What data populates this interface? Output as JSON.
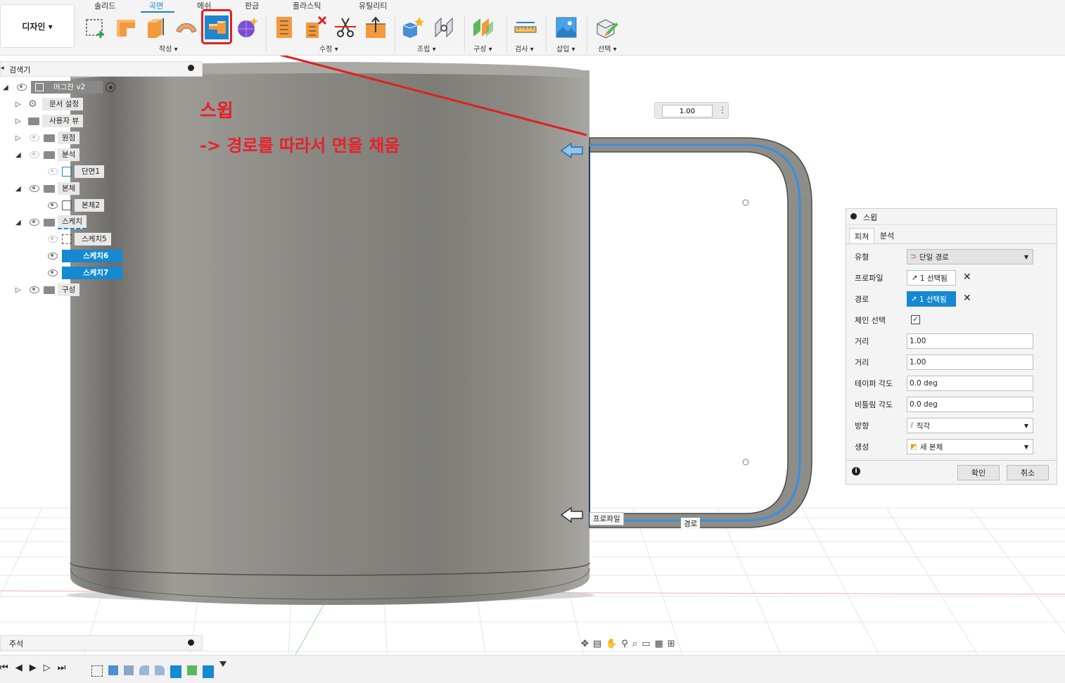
{
  "workspace": {
    "label": "디자인 ▾"
  },
  "tabs": [
    {
      "label": "솔리드",
      "active": false
    },
    {
      "label": "곡면",
      "active": true
    },
    {
      "label": "메쉬",
      "active": false
    },
    {
      "label": "판금",
      "active": false
    },
    {
      "label": "플라스틱",
      "active": false
    },
    {
      "label": "유틸리티",
      "active": false
    }
  ],
  "groups": {
    "create": "작성 ▾",
    "modify": "수정 ▾",
    "assemble": "조립 ▾",
    "construct": "구성 ▾",
    "inspect": "검사 ▾",
    "insert": "삽입 ▾",
    "select": "선택 ▾"
  },
  "annotation": {
    "title": "스윕",
    "description": "-> 경로를 따라서 면을 채움",
    "color": "#e8202a"
  },
  "browser": {
    "title": "검색기",
    "root": "머그잔 v2",
    "nodes": [
      {
        "label": "문서 설정"
      },
      {
        "label": "사용자 뷰"
      },
      {
        "label": "원점"
      },
      {
        "label": "분석"
      },
      {
        "label": "단면1"
      },
      {
        "label": "본체"
      },
      {
        "label": "본체2"
      },
      {
        "label": "스케치"
      },
      {
        "label": "스케치5"
      },
      {
        "label": "스케치6",
        "selected": true
      },
      {
        "label": "스케치7",
        "selected": true
      },
      {
        "label": "구성"
      }
    ]
  },
  "viewport": {
    "distance_input": "1.00",
    "profile_label": "프로파일",
    "path_label": "경로"
  },
  "dialog": {
    "title": "스윕",
    "tabs": [
      "피쳐",
      "분석"
    ],
    "rows": {
      "type_label": "유형",
      "type_value": "단일 경로",
      "profile_label": "프로파일",
      "profile_value": "1 선택됨",
      "path_label": "경로",
      "path_value": "1 선택됨",
      "chain_label": "체인 선택",
      "distance1_label": "거리",
      "distance1_value": "1.00",
      "distance2_label": "거리",
      "distance2_value": "1.00",
      "taper_label": "테이퍼 각도",
      "taper_value": "0.0 deg",
      "twist_label": "비틀림 각도",
      "twist_value": "0.0 deg",
      "orientation_label": "방향",
      "orientation_value": "직각",
      "operation_label": "생성",
      "operation_value": "새 본체"
    },
    "ok": "확인",
    "cancel": "취소"
  },
  "comments": {
    "title": "주석"
  },
  "colors": {
    "accent": "#1a7fd6",
    "selection": "#1589d1",
    "path": "#3a8ee0"
  }
}
